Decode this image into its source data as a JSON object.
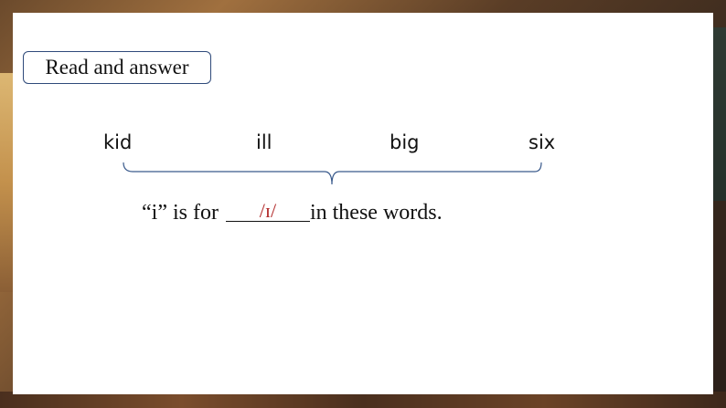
{
  "title": "Read and answer",
  "words": [
    "kid",
    "ill",
    "big",
    "six"
  ],
  "sentence": {
    "before": "“i” is for ",
    "answer": "/ɪ/",
    "after": "in these words."
  },
  "colors": {
    "answer": "#b22b2b",
    "title_border": "#2f4a7a",
    "brace": "#3a5a8c"
  }
}
